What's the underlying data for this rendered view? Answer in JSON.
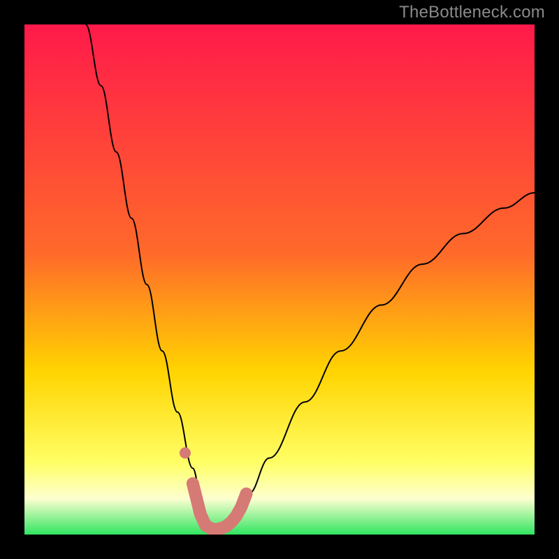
{
  "watermark": "TheBottleneck.com",
  "colors": {
    "bg_top": "#ff1a4a",
    "bg_mid1": "#ff6a2a",
    "bg_mid2": "#ffd400",
    "bg_mid3": "#ffff66",
    "bg_low": "#fdffd0",
    "bg_green": "#30e560",
    "frame": "#000000",
    "curve": "#000000",
    "marker": "#d67a76"
  },
  "chart_data": {
    "type": "line",
    "title": "",
    "xlabel": "",
    "ylabel": "",
    "xlim": [
      0,
      100
    ],
    "ylim": [
      0,
      100
    ],
    "series": [
      {
        "name": "bottleneck-curve",
        "x": [
          12,
          15,
          18,
          21,
          24,
          27,
          30,
          33,
          35,
          36,
          37,
          38,
          40,
          42,
          44,
          48,
          55,
          62,
          70,
          78,
          86,
          94,
          100
        ],
        "y": [
          100,
          88,
          75,
          62,
          49,
          36,
          24,
          13,
          5,
          2,
          1,
          1,
          2,
          4,
          8,
          15,
          26,
          36,
          45,
          53,
          59,
          64,
          67
        ]
      }
    ],
    "markers": {
      "name": "highlight-points",
      "x": [
        33.0,
        34.5,
        35.5,
        36.5,
        37.5,
        38.5,
        39.5,
        40.5,
        41.5,
        42.5,
        43.5
      ],
      "y": [
        10.0,
        4.0,
        1.8,
        1.2,
        1.0,
        1.2,
        1.6,
        2.4,
        3.6,
        5.4,
        8.0
      ]
    },
    "extra_marker": {
      "x": 31.5,
      "y": 16
    },
    "gradient_stops": [
      {
        "pct": 0,
        "key": "bg_top"
      },
      {
        "pct": 45,
        "key": "bg_mid1"
      },
      {
        "pct": 68,
        "key": "bg_mid2"
      },
      {
        "pct": 86,
        "key": "bg_mid3"
      },
      {
        "pct": 93,
        "key": "bg_low"
      },
      {
        "pct": 100,
        "key": "bg_green"
      }
    ]
  }
}
